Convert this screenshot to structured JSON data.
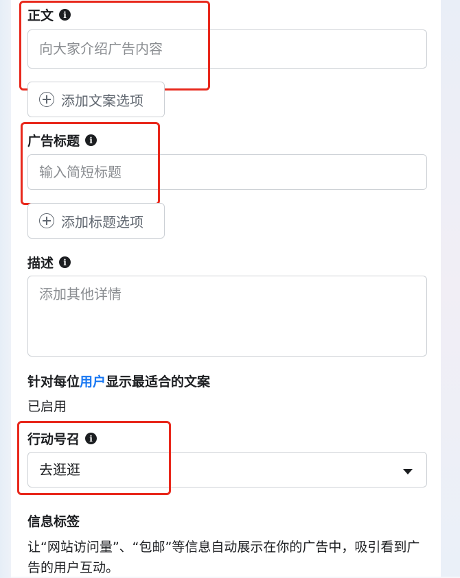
{
  "body_text": {
    "label": "正文",
    "placeholder": "向大家介绍广告内容",
    "add_option": "添加文案选项"
  },
  "headline": {
    "label": "广告标题",
    "placeholder": "输入简短标题",
    "add_option": "添加标题选项"
  },
  "description": {
    "label": "描述",
    "placeholder": "添加其他详情"
  },
  "optimize": {
    "title_prefix": "针对每位",
    "title_link": "用户",
    "title_suffix": "显示最适合的文案",
    "status": "已启用"
  },
  "cta": {
    "label": "行动号召",
    "selected": "去逛逛"
  },
  "info_labels": {
    "title": "信息标签",
    "text": "让“网站访问量”、“包邮”等信息自动展示在你的广告中，吸引看到广告的用户互动。"
  },
  "icons": {
    "info": "info-icon",
    "plus": "plus-circle-icon",
    "caret": "caret-down-icon"
  },
  "colors": {
    "highlight": "#e8281c",
    "link": "#1877f2"
  }
}
